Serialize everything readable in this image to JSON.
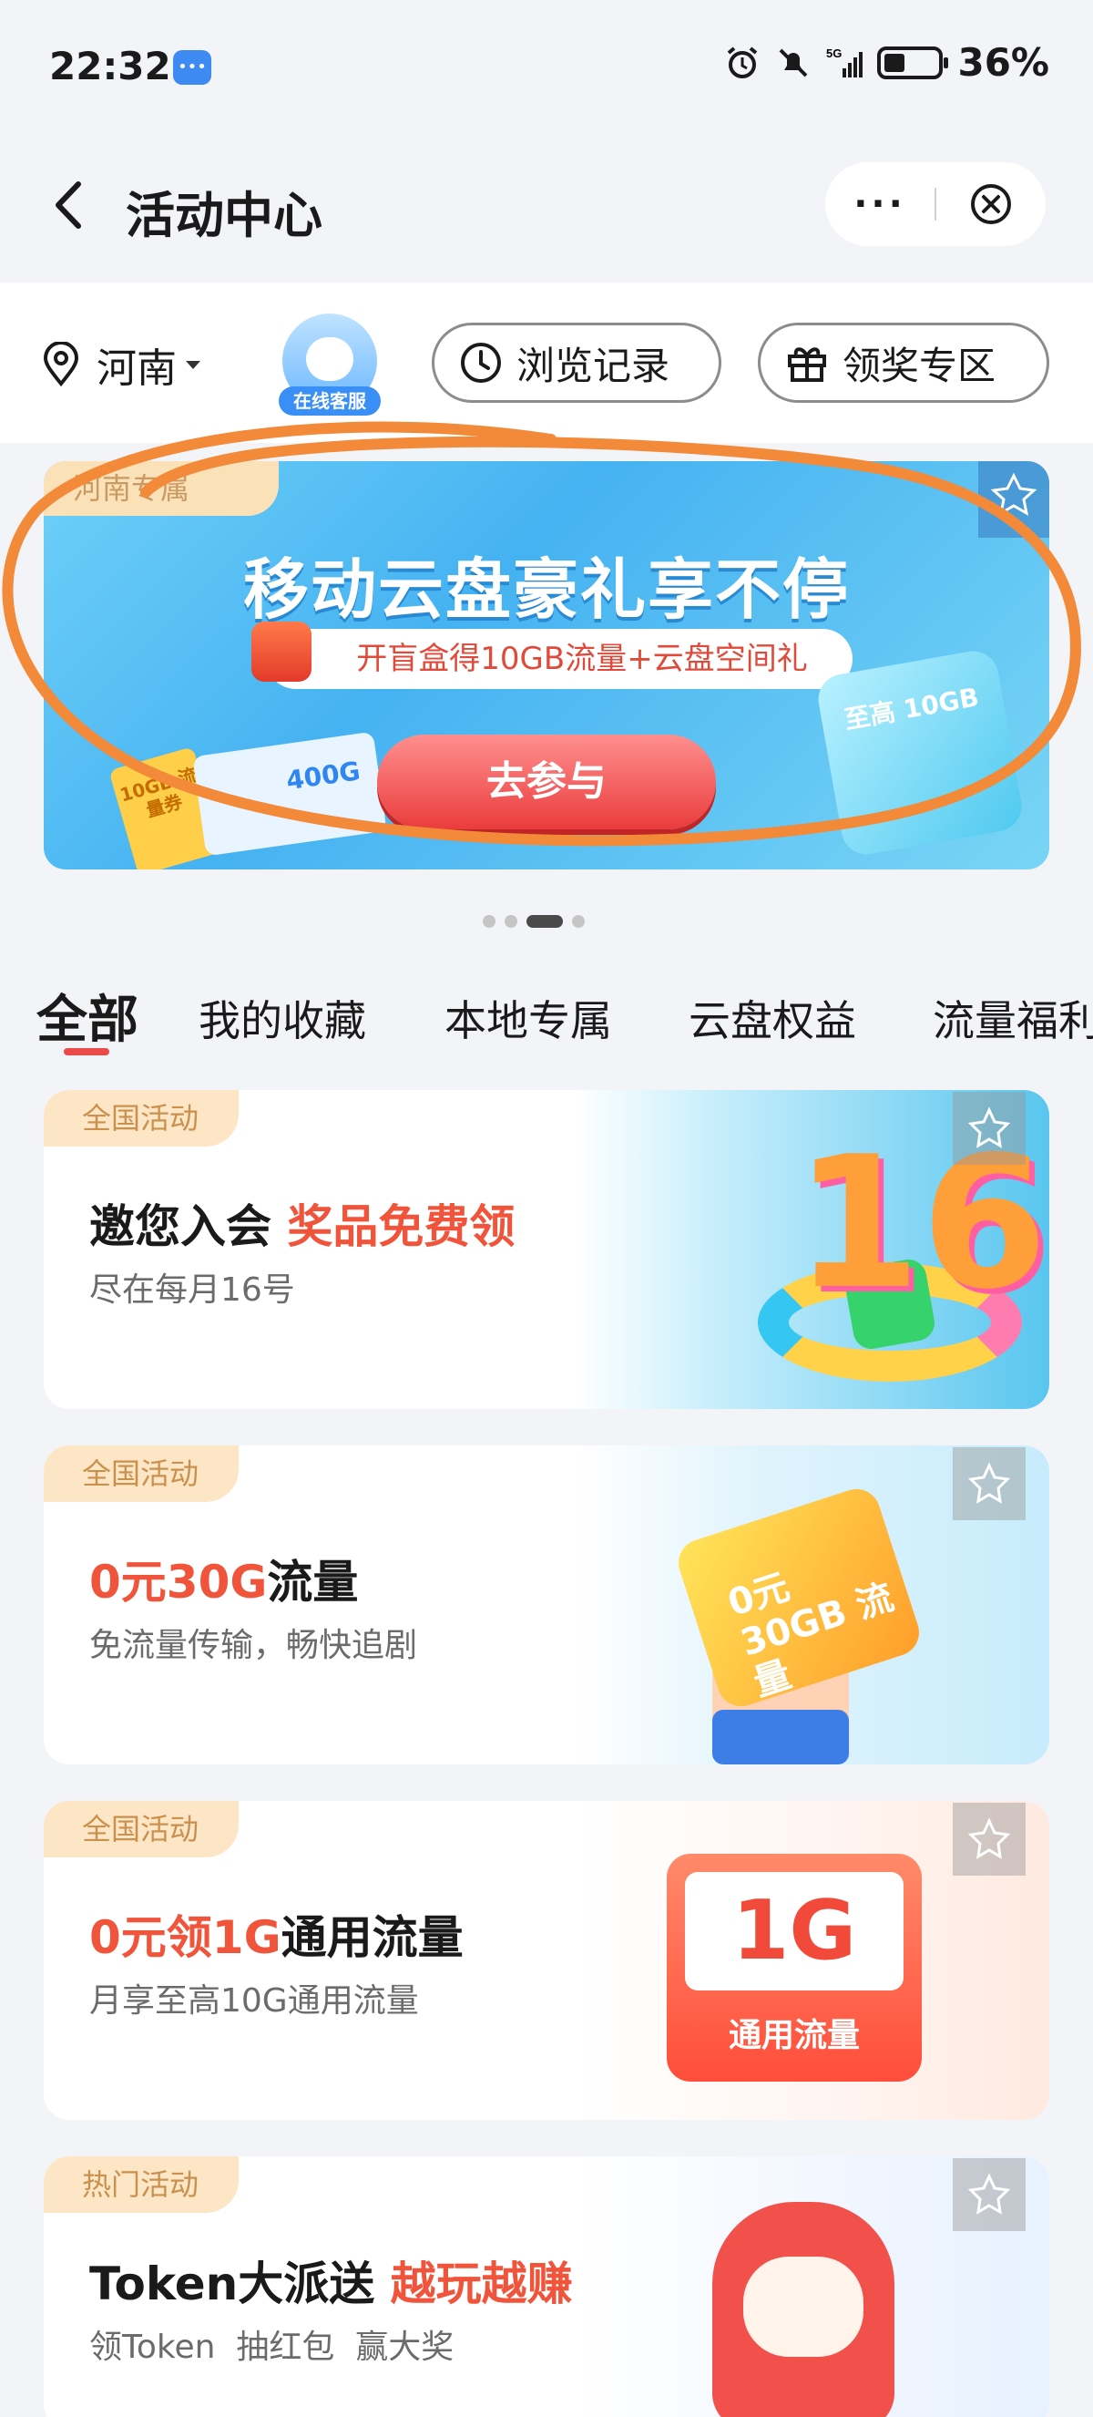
{
  "status_bar": {
    "time": "22:32",
    "network": "5G",
    "battery": "36%"
  },
  "header": {
    "title": "活动中心",
    "more": "···"
  },
  "filters": {
    "region": "河南",
    "service_label": "在线客服",
    "history_label": "浏览记录",
    "prize_label": "领奖专区"
  },
  "banner": {
    "corner_tag": "河南专属",
    "headline": "移动云盘豪礼享不停",
    "subline": "开盲盒得10GB流量+云盘空间礼",
    "button": "去参与",
    "ticket": "10GB 流量券",
    "card_value": "400G",
    "cube_text": "至高 10GB"
  },
  "tabs": [
    "全部",
    "我的收藏",
    "本地专属",
    "云盘权益",
    "流量福利"
  ],
  "cards": [
    {
      "tag": "全国活动",
      "title": "邀您入会 ",
      "title_highlight": "奖品免费领",
      "desc": "尽在每月16号",
      "art_text": "16"
    },
    {
      "tag": "全国活动",
      "title_highlight": "0元30G",
      "title": "流量",
      "desc": "免流量传输，畅快追剧",
      "art_text": "0元 30GB 流量"
    },
    {
      "tag": "全国活动",
      "title_highlight": "0元领1G",
      "title": "通用流量",
      "desc": "月享至高10G通用流量",
      "art_big": "1G",
      "art_label": "通用流量"
    },
    {
      "tag": "热门活动",
      "title": "Token大派送 ",
      "title_highlight": "越玩越赚",
      "desc": "领Token  抽红包  赢大奖"
    }
  ],
  "colors": {
    "accent_red": "#f0553c",
    "tag_bg": "#fde6c6",
    "tag_text": "#c9904e",
    "scribble": "#f28a3a"
  }
}
